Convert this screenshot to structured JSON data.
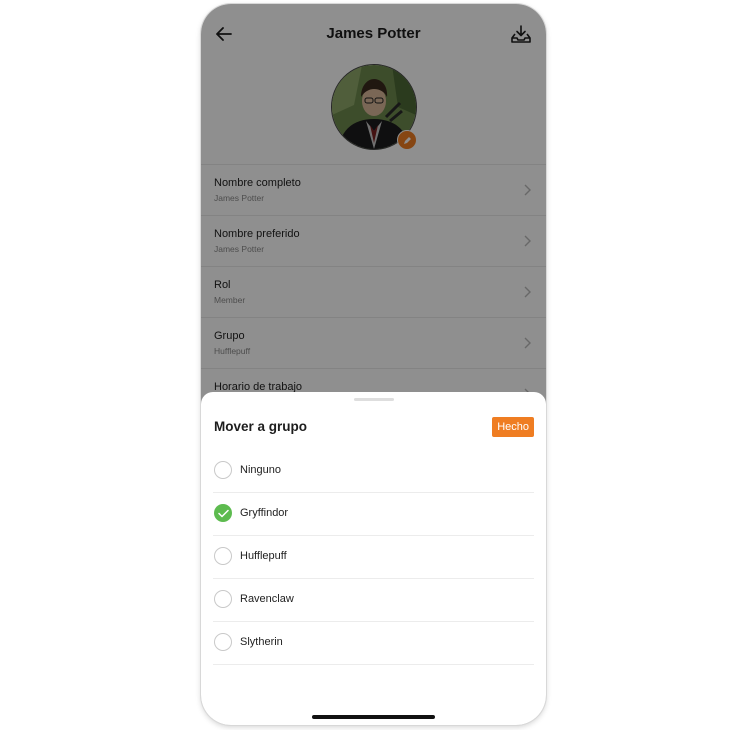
{
  "header": {
    "title": "James Potter",
    "back_icon": "arrow-left-icon",
    "action_icon": "download-tray-icon"
  },
  "profile": {
    "avatar_icon": "avatar-photo",
    "edit_icon": "pencil-icon",
    "fields": [
      {
        "label": "Nombre completo",
        "value": "James Potter"
      },
      {
        "label": "Nombre preferido",
        "value": "James Potter"
      },
      {
        "label": "Rol",
        "value": "Member"
      },
      {
        "label": "Grupo",
        "value": "Hufflepuff"
      },
      {
        "label": "Horario de trabajo",
        "value": ""
      }
    ]
  },
  "sheet": {
    "title": "Mover a grupo",
    "done_label": "Hecho",
    "options": [
      {
        "label": "Ninguno",
        "selected": false
      },
      {
        "label": "Gryffindor",
        "selected": true
      },
      {
        "label": "Hufflepuff",
        "selected": false
      },
      {
        "label": "Ravenclaw",
        "selected": false
      },
      {
        "label": "Slytherin",
        "selected": false
      }
    ]
  },
  "colors": {
    "accent": "#ef7d22",
    "selected": "#5dbb4f",
    "overlay": "rgba(0,0,0,0.44)"
  }
}
